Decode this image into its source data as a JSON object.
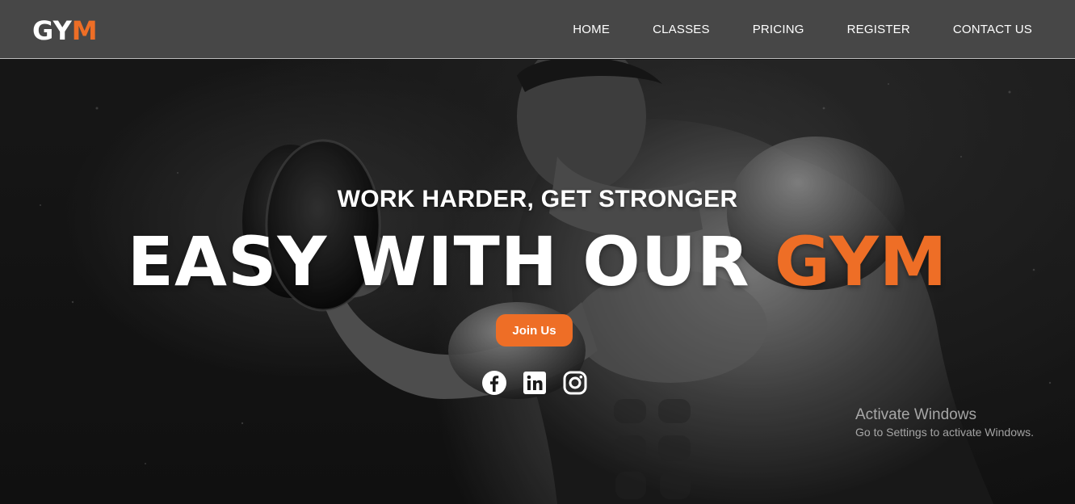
{
  "brand": {
    "logo_main": "GY",
    "logo_accent": "M",
    "accent_color": "#ee6e26",
    "navbar_color": "#474747"
  },
  "nav": {
    "items": [
      {
        "label": "HOME"
      },
      {
        "label": "CLASSES"
      },
      {
        "label": "PRICING"
      },
      {
        "label": "REGISTER"
      },
      {
        "label": "CONTACT US"
      }
    ]
  },
  "hero": {
    "tagline": "WORK HARDER, GET STRONGER",
    "headline_main": "EASY WITH OUR ",
    "headline_accent": "GYM",
    "cta_label": "Join Us",
    "background": "monochrome-photo-man-lifting-dumbbell"
  },
  "socials": [
    {
      "icon": "facebook-icon"
    },
    {
      "icon": "linkedin-icon"
    },
    {
      "icon": "instagram-icon"
    }
  ],
  "watermark": {
    "title": "Activate Windows",
    "subtitle": "Go to Settings to activate Windows."
  }
}
